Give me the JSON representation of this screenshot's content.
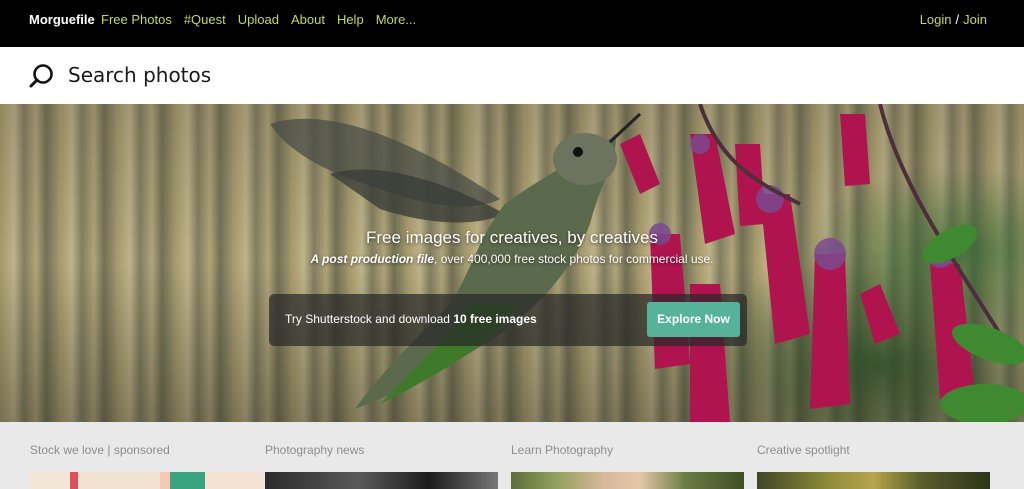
{
  "nav": {
    "brand": "Morguefile",
    "links": [
      "Free Photos",
      "#Quest",
      "Upload",
      "About",
      "Help",
      "More..."
    ],
    "login": "Login",
    "separator": "/",
    "join": "Join"
  },
  "search": {
    "placeholder": "Search photos"
  },
  "hero": {
    "headline": "Free images for creatives, by creatives",
    "sub_emph": "A post production file",
    "sub_rest": ", over 400,000 free stock photos for commercial use.",
    "promo_prefix": "Try Shutterstock and download ",
    "promo_bold": "10 free images",
    "promo_button": "Explore Now"
  },
  "sections": [
    {
      "title": "Stock we love | sponsored"
    },
    {
      "title": "Photography news"
    },
    {
      "title": "Learn Photography"
    },
    {
      "title": "Creative spotlight"
    }
  ],
  "colors": {
    "nav_bg": "#000000",
    "nav_link": "#c3d95a",
    "button": "#56b399",
    "section_bg": "#e9e9e9"
  }
}
